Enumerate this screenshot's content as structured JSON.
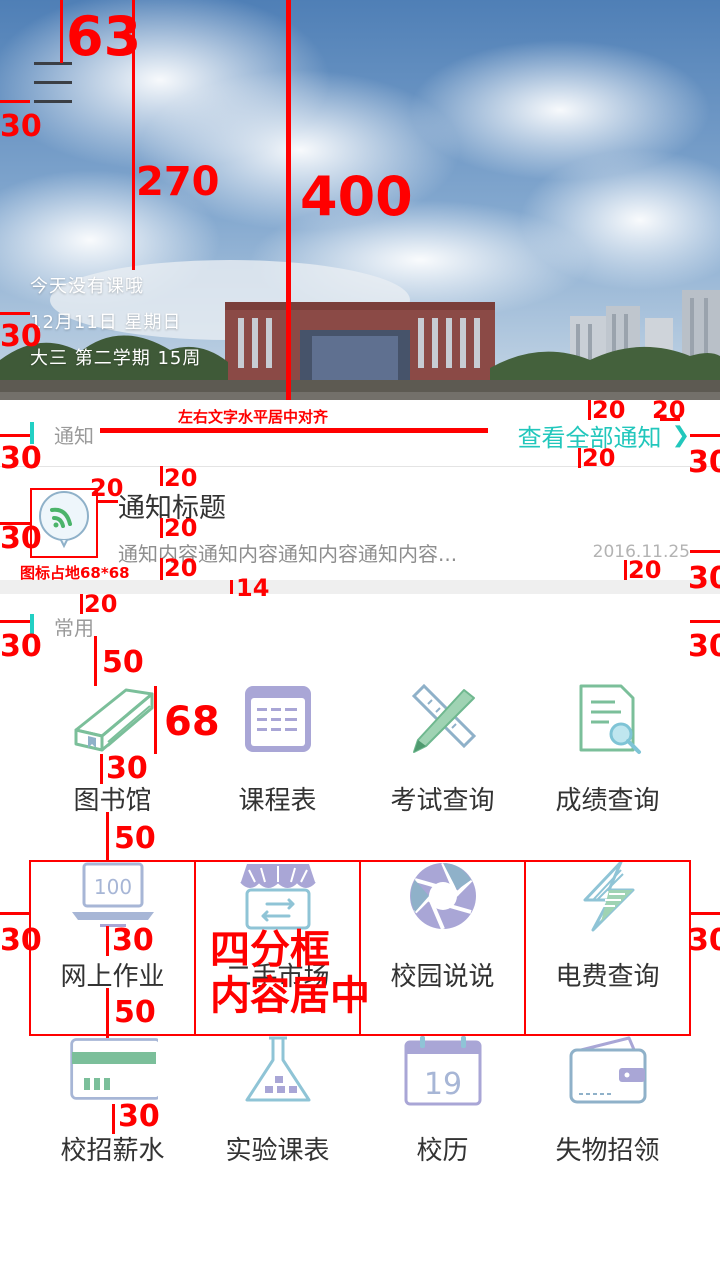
{
  "hero": {
    "line1": "今天没有课哦",
    "line2": "12月11日 星期日",
    "line3": "大三 第二学期 15周"
  },
  "notice": {
    "section_title": "通知",
    "view_all": "查看全部通知",
    "title": "通知标题",
    "content": "通知内容通知内容通知内容通知内容...",
    "date": "2016.11.25"
  },
  "common": {
    "section_title": "常用",
    "items": [
      {
        "label": "图书馆",
        "icon": "book-icon"
      },
      {
        "label": "课程表",
        "icon": "calendar-table-icon"
      },
      {
        "label": "考试查询",
        "icon": "pencil-ruler-icon"
      },
      {
        "label": "成绩查询",
        "icon": "document-search-icon"
      },
      {
        "label": "网上作业",
        "icon": "laptop-icon"
      },
      {
        "label": "二手市场",
        "icon": "shop-icon"
      },
      {
        "label": "校园说说",
        "icon": "aperture-icon"
      },
      {
        "label": "电费查询",
        "icon": "lightning-icon"
      },
      {
        "label": "校招薪水",
        "icon": "salary-card-icon"
      },
      {
        "label": "实验课表",
        "icon": "flask-icon"
      },
      {
        "label": "校历",
        "icon": "calendar-19-icon"
      },
      {
        "label": "失物招领",
        "icon": "wallet-icon"
      }
    ]
  },
  "calendar_icon_day": "19",
  "laptop_icon_value": "100",
  "colors": {
    "accent": "#22c7bc",
    "annotation": "#ff0000",
    "text_dark": "#333333",
    "text_gray": "#8e8e8e"
  },
  "annotations": {
    "a63": "63",
    "a270": "270",
    "a400": "400",
    "a30_1": "30",
    "a30_2": "30",
    "center_align": "左右文字水平居中对齐",
    "a20_1": "20",
    "a20_2": "20",
    "a20_3": "20",
    "a30_3": "30",
    "a30_4": "30",
    "a20_4": "20",
    "a20_5": "20",
    "a20_6": "20",
    "a20_7": "20",
    "a30_5": "30",
    "a30_6": "30",
    "icon_area": "图标占地68*68",
    "a20_8": "20",
    "a14": "14",
    "a20_9": "20",
    "a30_7": "30",
    "a30_8": "30",
    "a30_9": "30",
    "a50_1": "50",
    "a68": "68",
    "a30_10": "30",
    "a50_2": "50",
    "a30_11": "30",
    "a30_12": "30",
    "a30_13": "30",
    "quad_line1": "四分框",
    "quad_line2": "内容居中",
    "a50_3": "50",
    "a30_14": "30"
  }
}
